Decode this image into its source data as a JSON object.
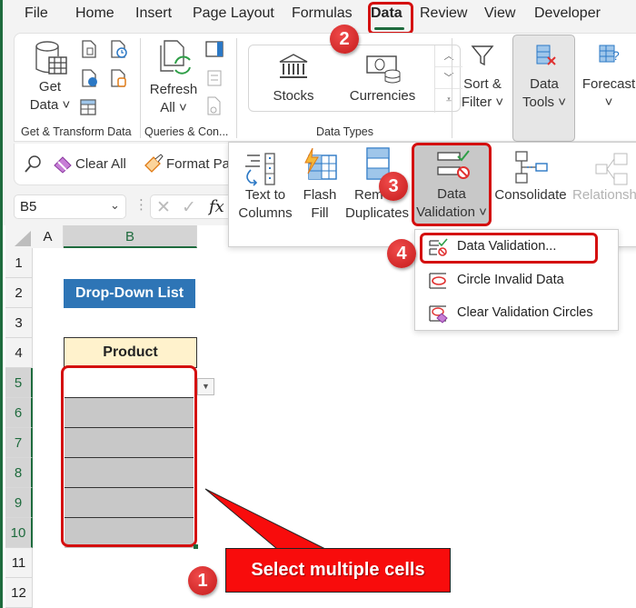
{
  "tabs": [
    {
      "label": "File"
    },
    {
      "label": "Home"
    },
    {
      "label": "Insert"
    },
    {
      "label": "Page Layout"
    },
    {
      "label": "Formulas"
    },
    {
      "label": "Data",
      "active": true
    },
    {
      "label": "Review"
    },
    {
      "label": "View"
    },
    {
      "label": "Developer"
    }
  ],
  "ribbon": {
    "get_data": {
      "line1": "Get",
      "line2": "Data ˅"
    },
    "refresh_all": {
      "line1": "Refresh",
      "line2": "All ˅"
    },
    "stocks": "Stocks",
    "currencies": "Currencies",
    "sort_filter": {
      "line1": "Sort &",
      "line2": "Filter ˅"
    },
    "data_tools": {
      "line1": "Data",
      "line2": "Tools ˅"
    },
    "forecast": {
      "line1": "Forecast",
      "line2": "˅"
    },
    "groups": {
      "get_transform": "Get & Transform Data",
      "queries": "Queries & Con...",
      "data_types": "Data Types"
    }
  },
  "quickbar": {
    "clear_all": "Clear All",
    "format_painter": "Format Pa"
  },
  "formula_bar": {
    "name_box": "B5",
    "fx": "fx"
  },
  "data_tools_panel": {
    "text_to_columns": {
      "line1": "Text to",
      "line2": "Columns"
    },
    "flash_fill": {
      "line1": "Flash",
      "line2": "Fill"
    },
    "remove_duplicates": {
      "line1": "Rem",
      "line2": "Duplicates"
    },
    "data_validation": {
      "line1": "Data",
      "line2": "Validation ˅"
    },
    "consolidate": "Consolidate",
    "relationships": "Relationship"
  },
  "validation_menu": {
    "items": [
      {
        "label": "Data Validation..."
      },
      {
        "label": "Circle Invalid Data"
      },
      {
        "label": "Clear Validation Circles"
      }
    ]
  },
  "sheet": {
    "columns": [
      "A",
      "B"
    ],
    "rows": [
      "1",
      "2",
      "3",
      "4",
      "5",
      "6",
      "7",
      "8",
      "9",
      "10",
      "11",
      "12"
    ],
    "selected_rows": [
      "5",
      "6",
      "7",
      "8",
      "9",
      "10"
    ],
    "title": "Drop-Down List",
    "header": "Product"
  },
  "callouts": {
    "step1": "1",
    "step2": "2",
    "step3": "3",
    "step4": "4",
    "step1_text": "Select multiple cells"
  },
  "colors": {
    "accent_green": "#1e6b3d",
    "highlight_red": "#d40f0f",
    "title_blue": "#2e75b6",
    "header_yellow": "#fff2cc"
  }
}
